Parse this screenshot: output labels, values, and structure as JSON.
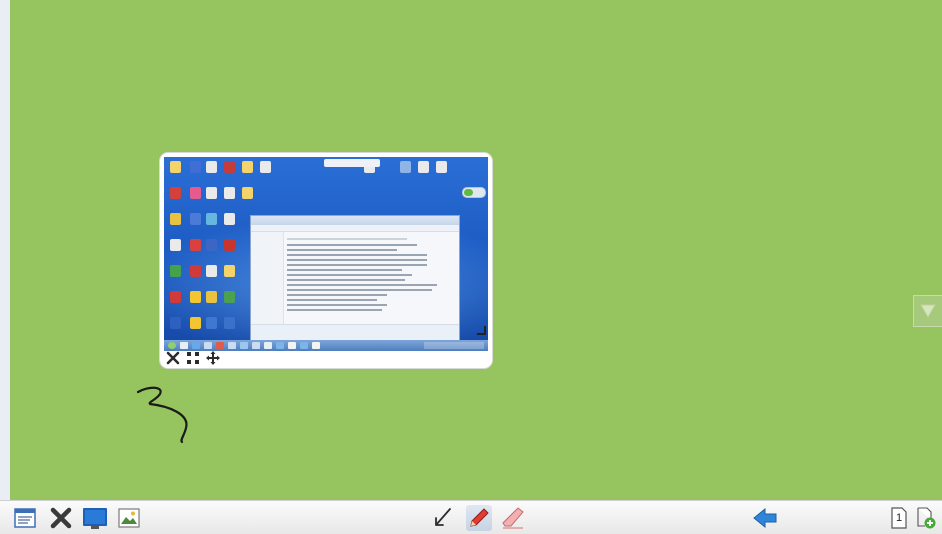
{
  "board": {
    "background": "#96c45e"
  },
  "card": {
    "tools": [
      {
        "name": "close-card-icon",
        "glyph": "✕"
      },
      {
        "name": "resize-card-icon",
        "glyph": "⤡"
      },
      {
        "name": "move-card-icon",
        "glyph": "✥"
      }
    ]
  },
  "toolbar": {
    "page_number": "1",
    "items": [
      "menu-icon",
      "clear-icon",
      "screen-capture-icon",
      "image-icon",
      "select-arrow-icon",
      "pen-icon",
      "eraser-icon",
      "back-arrow-icon",
      "page-icon",
      "add-page-icon"
    ]
  }
}
